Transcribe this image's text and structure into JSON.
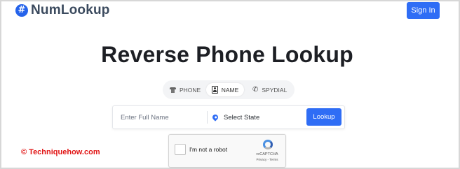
{
  "header": {
    "logo_symbol": "#",
    "logo_text": "NumLookup",
    "signin_label": "Sign In"
  },
  "main": {
    "title": "Reverse Phone Lookup",
    "tabs": [
      {
        "label": "PHONE",
        "icon": "telephone-icon",
        "active": false
      },
      {
        "label": "NAME",
        "icon": "id-card-icon",
        "active": true
      },
      {
        "label": "SPYDIAL",
        "icon": "phone-handset-icon",
        "active": false
      }
    ],
    "search": {
      "name_placeholder": "Enter Full Name",
      "name_value": "",
      "state_value": "Select State",
      "lookup_label": "Lookup"
    },
    "captcha": {
      "label": "I'm not a robot",
      "brand": "reCAPTCHA",
      "links": "Privacy - Terms"
    }
  },
  "watermark": "© Techniquehow.com",
  "colors": {
    "accent": "#2f6df5",
    "watermark": "#e11515",
    "title": "#1d1f24"
  }
}
